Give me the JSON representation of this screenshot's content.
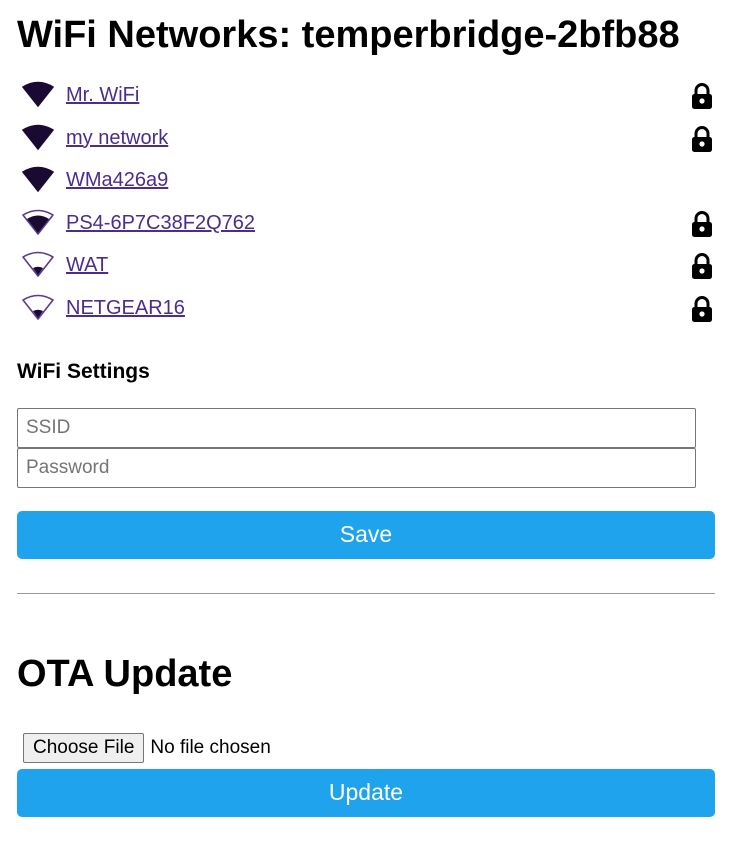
{
  "header": {
    "title": "WiFi Networks: temperbridge-2bfb88"
  },
  "networks": [
    {
      "ssid": "Mr. WiFi",
      "signal_bars": 4,
      "secured": true
    },
    {
      "ssid": "my network",
      "signal_bars": 4,
      "secured": true
    },
    {
      "ssid": "WMa426a9",
      "signal_bars": 4,
      "secured": false
    },
    {
      "ssid": "PS4-6P7C38F2Q762",
      "signal_bars": 3,
      "secured": true
    },
    {
      "ssid": "WAT",
      "signal_bars": 1,
      "secured": true
    },
    {
      "ssid": "NETGEAR16",
      "signal_bars": 1,
      "secured": true
    }
  ],
  "settings": {
    "title": "WiFi Settings",
    "ssid_placeholder": "SSID",
    "ssid_value": "",
    "password_placeholder": "Password",
    "password_value": "",
    "save_label": "Save"
  },
  "ota": {
    "title": "OTA Update",
    "choose_file_label": "Choose File",
    "file_status": "No file chosen",
    "update_label": "Update"
  },
  "colors": {
    "button_bg": "#1fa3ec",
    "link": "#4b2c8f",
    "signal_dark": "#1a0a33",
    "signal_outline": "#5a3a8f"
  },
  "icons": {
    "signal": "wifi-signal-icon",
    "lock": "lock-icon"
  }
}
